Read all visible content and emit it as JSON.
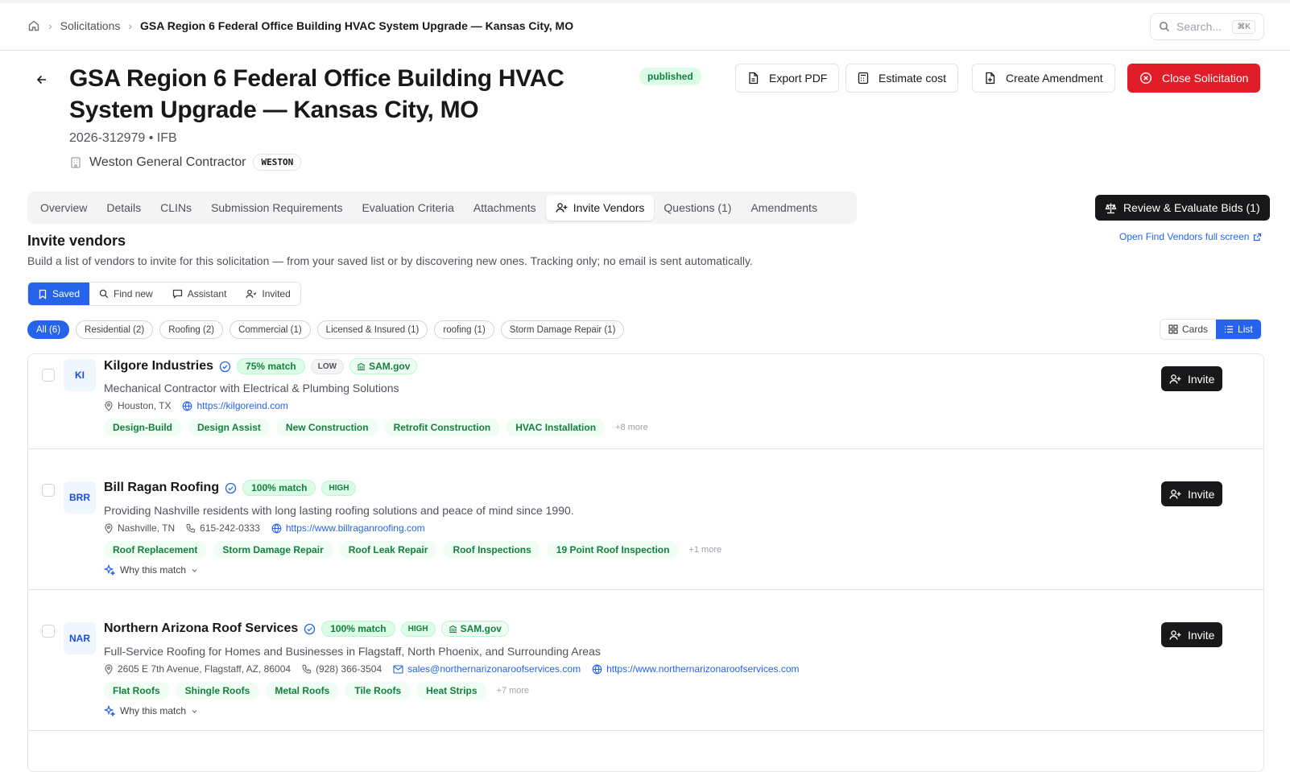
{
  "breadcrumb": {
    "items": [
      "Solicitations"
    ],
    "current": "GSA Region 6 Federal Office Building HVAC System Upgrade — Kansas City, MO"
  },
  "search": {
    "placeholder": "Search...",
    "shortcut": "⌘K"
  },
  "header": {
    "title": "GSA Region 6 Federal Office Building HVAC System Upgrade — Kansas City, MO",
    "status": "published",
    "subtitle": "2026-312979 • IFB",
    "org_name": "Weston General Contractor",
    "org_code": "WESTON"
  },
  "actions": {
    "export": "Export PDF",
    "estimate": "Estimate cost",
    "amendment": "Create Amendment",
    "close": "Close Solicitation"
  },
  "tabs": [
    {
      "label": "Overview"
    },
    {
      "label": "Details"
    },
    {
      "label": "CLINs"
    },
    {
      "label": "Submission Requirements"
    },
    {
      "label": "Evaluation Criteria"
    },
    {
      "label": "Attachments"
    },
    {
      "label": "Invite Vendors"
    },
    {
      "label": "Questions (1)"
    },
    {
      "label": "Amendments"
    }
  ],
  "review_button": "Review & Evaluate Bids (1)",
  "section": {
    "title": "Invite vendors",
    "description": "Build a list of vendors to invite for this solicitation — from your saved list or by discovering new ones. Tracking only; no email is sent automatically.",
    "open_link": "Open Find Vendors full screen"
  },
  "modes": [
    "Saved",
    "Find new",
    "Assistant",
    "Invited"
  ],
  "filters": [
    "All (6)",
    "Residential (2)",
    "Roofing (2)",
    "Commercial (1)",
    "Licensed & Insured (1)",
    "roofing (1)",
    "Storm Damage Repair (1)"
  ],
  "view": {
    "cards": "Cards",
    "list": "List"
  },
  "vendors": [
    {
      "initials": "KI",
      "name": "Kilgore Industries",
      "match": "75% match",
      "level": "LOW",
      "sam": "SAM.gov",
      "description": "Mechanical Contractor with Electrical & Plumbing Solutions",
      "location": "Houston, TX",
      "website": "https://kilgoreind.com",
      "tags": [
        "Design-Build",
        "Design Assist",
        "New Construction",
        "Retrofit Construction",
        "HVAC Installation"
      ],
      "more": "+8 more",
      "invite": "Invite"
    },
    {
      "initials": "BRR",
      "name": "Bill Ragan Roofing",
      "match": "100% match",
      "level": "HIGH",
      "description": "Providing Nashville residents with long lasting roofing solutions and peace of mind since 1990.",
      "location": "Nashville, TN",
      "phone": "615-242-0333",
      "website": "https://www.billraganroofing.com",
      "tags": [
        "Roof Replacement",
        "Storm Damage Repair",
        "Roof Leak Repair",
        "Roof Inspections",
        "19 Point Roof Inspection"
      ],
      "more": "+1 more",
      "why": "Why this match",
      "invite": "Invite"
    },
    {
      "initials": "NAR",
      "name": "Northern Arizona Roof Services",
      "match": "100% match",
      "level": "HIGH",
      "sam": "SAM.gov",
      "description": "Full-Service Roofing for Homes and Businesses in Flagstaff, North Phoenix, and Surrounding Areas",
      "location": "2605 E 7th Avenue, Flagstaff, AZ, 86004",
      "phone": "(928) 366-3504",
      "email": "sales@northernarizonaroofservices.com",
      "website": "https://www.northernarizonaroofservices.com",
      "tags": [
        "Flat Roofs",
        "Shingle Roofs",
        "Metal Roofs",
        "Tile Roofs",
        "Heat Strips"
      ],
      "more": "+7 more",
      "why": "Why this match",
      "invite": "Invite"
    }
  ],
  "colors": {
    "accent": "#2563eb",
    "danger": "#e11d2a",
    "success": "#15803d",
    "dark": "#18181b"
  }
}
